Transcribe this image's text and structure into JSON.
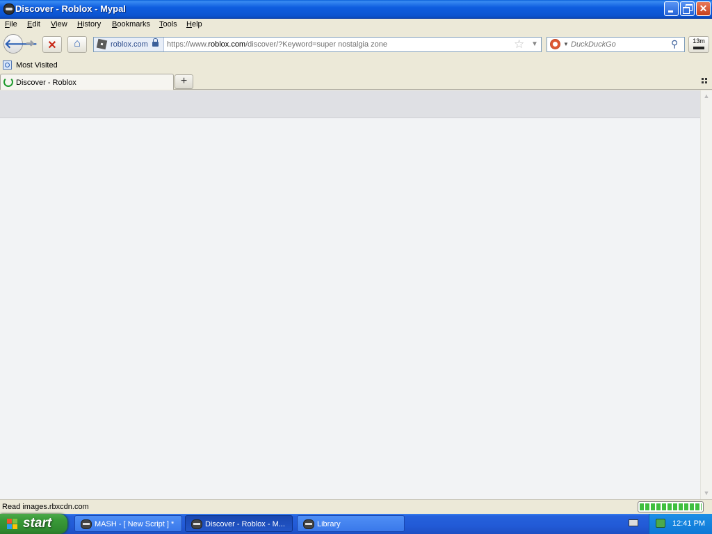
{
  "window": {
    "title": "Discover - Roblox - Mypal"
  },
  "menu": [
    {
      "label": "File",
      "accel": "F",
      "rest": "ile"
    },
    {
      "label": "Edit",
      "accel": "E",
      "rest": "dit"
    },
    {
      "label": "View",
      "accel": "V",
      "rest": "iew"
    },
    {
      "label": "History",
      "accel": "H",
      "rest": "istory"
    },
    {
      "label": "Bookmarks",
      "accel": "B",
      "rest": "ookmarks"
    },
    {
      "label": "Tools",
      "accel": "T",
      "rest": "ools"
    },
    {
      "label": "Help",
      "accel": "H",
      "rest": "elp"
    }
  ],
  "nav": {
    "identity": "roblox.com",
    "url_prefix": "https://www.",
    "url_host": "roblox.com",
    "url_path": "/discover/?Keyword=super nostalgia zone",
    "search_placeholder": "DuckDuckGo",
    "extension_label": "13m"
  },
  "bookmarks": {
    "items": [
      {
        "label": "Most Visited"
      }
    ]
  },
  "tabs": [
    {
      "label": "Discover - Roblox",
      "loading": true
    }
  ],
  "status": {
    "text": "Read images.rbxcdn.com",
    "progress": 1.0
  },
  "taskbar": {
    "start_label": "start",
    "tasks": [
      {
        "label": "MASH - [ New Script ] *"
      },
      {
        "label": "Discover - Roblox - M..."
      },
      {
        "label": "Library"
      }
    ],
    "clock": "12:41 PM"
  },
  "colors": {
    "title_bar": "#0b53cf",
    "taskbar": "#225ad6",
    "start_button": "#3a9a38",
    "content_bg": "#f2f3f5",
    "content_header": "#dfe0e4"
  }
}
